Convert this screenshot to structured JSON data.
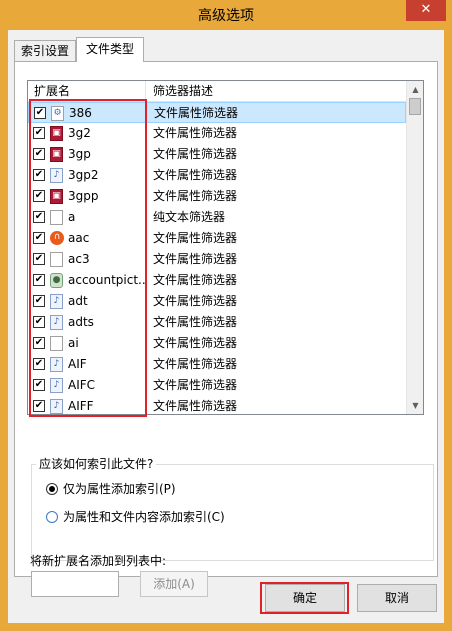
{
  "window": {
    "title": "高级选项",
    "close_glyph": "✕"
  },
  "tabs": [
    {
      "label": "索引设置",
      "active": false
    },
    {
      "label": "文件类型",
      "active": true
    }
  ],
  "list": {
    "columns": [
      "扩展名",
      "筛选器描述"
    ],
    "rows": [
      {
        "ext": "386",
        "desc": "文件属性筛选器",
        "checked": true,
        "icon": "generic-file-icon",
        "glyph": "⚙",
        "selected": true
      },
      {
        "ext": "3g2",
        "desc": "文件属性筛选器",
        "checked": true,
        "icon": "video-file-icon",
        "glyph": "▣"
      },
      {
        "ext": "3gp",
        "desc": "文件属性筛选器",
        "checked": true,
        "icon": "video-file-icon",
        "glyph": "▣"
      },
      {
        "ext": "3gp2",
        "desc": "文件属性筛选器",
        "checked": true,
        "icon": "media-file-icon",
        "glyph": "♪"
      },
      {
        "ext": "3gpp",
        "desc": "文件属性筛选器",
        "checked": true,
        "icon": "video-file-icon",
        "glyph": "▣"
      },
      {
        "ext": "a",
        "desc": "纯文本筛选器",
        "checked": true,
        "icon": "text-file-icon",
        "glyph": ""
      },
      {
        "ext": "aac",
        "desc": "文件属性筛选器",
        "checked": true,
        "icon": "headphones-icon",
        "glyph": "∩"
      },
      {
        "ext": "ac3",
        "desc": "文件属性筛选器",
        "checked": true,
        "icon": "text-file-icon",
        "glyph": ""
      },
      {
        "ext": "accountpict...",
        "desc": "文件属性筛选器",
        "checked": true,
        "icon": "user-file-icon",
        "glyph": "●"
      },
      {
        "ext": "adt",
        "desc": "文件属性筛选器",
        "checked": true,
        "icon": "media-file-icon",
        "glyph": "♪"
      },
      {
        "ext": "adts",
        "desc": "文件属性筛选器",
        "checked": true,
        "icon": "media-file-icon",
        "glyph": "♪"
      },
      {
        "ext": "ai",
        "desc": "文件属性筛选器",
        "checked": true,
        "icon": "text-file-icon",
        "glyph": ""
      },
      {
        "ext": "AIF",
        "desc": "文件属性筛选器",
        "checked": true,
        "icon": "media-file-icon",
        "glyph": "♪"
      },
      {
        "ext": "AIFC",
        "desc": "文件属性筛选器",
        "checked": true,
        "icon": "media-file-icon",
        "glyph": "♪"
      },
      {
        "ext": "AIFF",
        "desc": "文件属性筛选器",
        "checked": true,
        "icon": "media-file-icon",
        "glyph": "♪"
      }
    ],
    "scroll_up_glyph": "▲",
    "scroll_down_glyph": "▼",
    "check_glyph": "✔"
  },
  "index_group": {
    "legend": "应该如何索引此文件?",
    "options": [
      {
        "label": "仅为属性添加索引(P)",
        "selected": true
      },
      {
        "label": "为属性和文件内容添加索引(C)",
        "selected": false
      }
    ]
  },
  "add_extension": {
    "label": "将新扩展名添加到列表中:",
    "value": "",
    "button_label": "添加(A)",
    "button_enabled": false
  },
  "footer": {
    "ok_label": "确定",
    "cancel_label": "取消"
  },
  "colors": {
    "title_bar": "#e9a93a",
    "close_button": "#c7402f",
    "selection": "#cce8ff",
    "highlight_annotation": "#e0202a"
  }
}
